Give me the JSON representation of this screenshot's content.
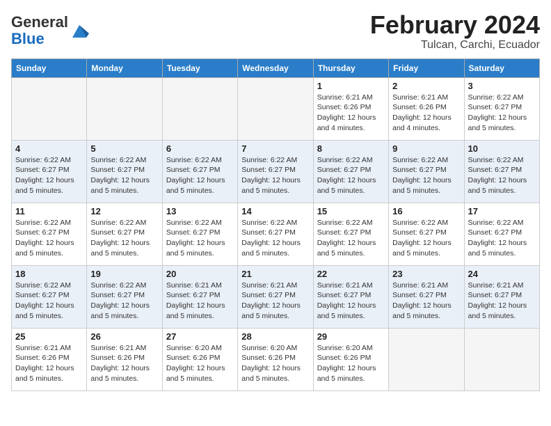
{
  "header": {
    "logo_general": "General",
    "logo_blue": "Blue",
    "month_year": "February 2024",
    "location": "Tulcan, Carchi, Ecuador"
  },
  "weekdays": [
    "Sunday",
    "Monday",
    "Tuesday",
    "Wednesday",
    "Thursday",
    "Friday",
    "Saturday"
  ],
  "weeks": [
    [
      {
        "day": "",
        "empty": true
      },
      {
        "day": "",
        "empty": true
      },
      {
        "day": "",
        "empty": true
      },
      {
        "day": "",
        "empty": true
      },
      {
        "day": "1",
        "sunrise": "6:21 AM",
        "sunset": "6:26 PM",
        "daylight": "12 hours and 4 minutes."
      },
      {
        "day": "2",
        "sunrise": "6:21 AM",
        "sunset": "6:26 PM",
        "daylight": "12 hours and 4 minutes."
      },
      {
        "day": "3",
        "sunrise": "6:22 AM",
        "sunset": "6:27 PM",
        "daylight": "12 hours and 5 minutes."
      }
    ],
    [
      {
        "day": "4",
        "sunrise": "6:22 AM",
        "sunset": "6:27 PM",
        "daylight": "12 hours and 5 minutes."
      },
      {
        "day": "5",
        "sunrise": "6:22 AM",
        "sunset": "6:27 PM",
        "daylight": "12 hours and 5 minutes."
      },
      {
        "day": "6",
        "sunrise": "6:22 AM",
        "sunset": "6:27 PM",
        "daylight": "12 hours and 5 minutes."
      },
      {
        "day": "7",
        "sunrise": "6:22 AM",
        "sunset": "6:27 PM",
        "daylight": "12 hours and 5 minutes."
      },
      {
        "day": "8",
        "sunrise": "6:22 AM",
        "sunset": "6:27 PM",
        "daylight": "12 hours and 5 minutes."
      },
      {
        "day": "9",
        "sunrise": "6:22 AM",
        "sunset": "6:27 PM",
        "daylight": "12 hours and 5 minutes."
      },
      {
        "day": "10",
        "sunrise": "6:22 AM",
        "sunset": "6:27 PM",
        "daylight": "12 hours and 5 minutes."
      }
    ],
    [
      {
        "day": "11",
        "sunrise": "6:22 AM",
        "sunset": "6:27 PM",
        "daylight": "12 hours and 5 minutes."
      },
      {
        "day": "12",
        "sunrise": "6:22 AM",
        "sunset": "6:27 PM",
        "daylight": "12 hours and 5 minutes."
      },
      {
        "day": "13",
        "sunrise": "6:22 AM",
        "sunset": "6:27 PM",
        "daylight": "12 hours and 5 minutes."
      },
      {
        "day": "14",
        "sunrise": "6:22 AM",
        "sunset": "6:27 PM",
        "daylight": "12 hours and 5 minutes."
      },
      {
        "day": "15",
        "sunrise": "6:22 AM",
        "sunset": "6:27 PM",
        "daylight": "12 hours and 5 minutes."
      },
      {
        "day": "16",
        "sunrise": "6:22 AM",
        "sunset": "6:27 PM",
        "daylight": "12 hours and 5 minutes."
      },
      {
        "day": "17",
        "sunrise": "6:22 AM",
        "sunset": "6:27 PM",
        "daylight": "12 hours and 5 minutes."
      }
    ],
    [
      {
        "day": "18",
        "sunrise": "6:22 AM",
        "sunset": "6:27 PM",
        "daylight": "12 hours and 5 minutes."
      },
      {
        "day": "19",
        "sunrise": "6:22 AM",
        "sunset": "6:27 PM",
        "daylight": "12 hours and 5 minutes."
      },
      {
        "day": "20",
        "sunrise": "6:21 AM",
        "sunset": "6:27 PM",
        "daylight": "12 hours and 5 minutes."
      },
      {
        "day": "21",
        "sunrise": "6:21 AM",
        "sunset": "6:27 PM",
        "daylight": "12 hours and 5 minutes."
      },
      {
        "day": "22",
        "sunrise": "6:21 AM",
        "sunset": "6:27 PM",
        "daylight": "12 hours and 5 minutes."
      },
      {
        "day": "23",
        "sunrise": "6:21 AM",
        "sunset": "6:27 PM",
        "daylight": "12 hours and 5 minutes."
      },
      {
        "day": "24",
        "sunrise": "6:21 AM",
        "sunset": "6:27 PM",
        "daylight": "12 hours and 5 minutes."
      }
    ],
    [
      {
        "day": "25",
        "sunrise": "6:21 AM",
        "sunset": "6:26 PM",
        "daylight": "12 hours and 5 minutes."
      },
      {
        "day": "26",
        "sunrise": "6:21 AM",
        "sunset": "6:26 PM",
        "daylight": "12 hours and 5 minutes."
      },
      {
        "day": "27",
        "sunrise": "6:20 AM",
        "sunset": "6:26 PM",
        "daylight": "12 hours and 5 minutes."
      },
      {
        "day": "28",
        "sunrise": "6:20 AM",
        "sunset": "6:26 PM",
        "daylight": "12 hours and 5 minutes."
      },
      {
        "day": "29",
        "sunrise": "6:20 AM",
        "sunset": "6:26 PM",
        "daylight": "12 hours and 5 minutes."
      },
      {
        "day": "",
        "empty": true
      },
      {
        "day": "",
        "empty": true
      }
    ]
  ],
  "labels": {
    "sunrise_prefix": "Sunrise: ",
    "sunset_prefix": "Sunset: ",
    "daylight_prefix": "Daylight: "
  }
}
